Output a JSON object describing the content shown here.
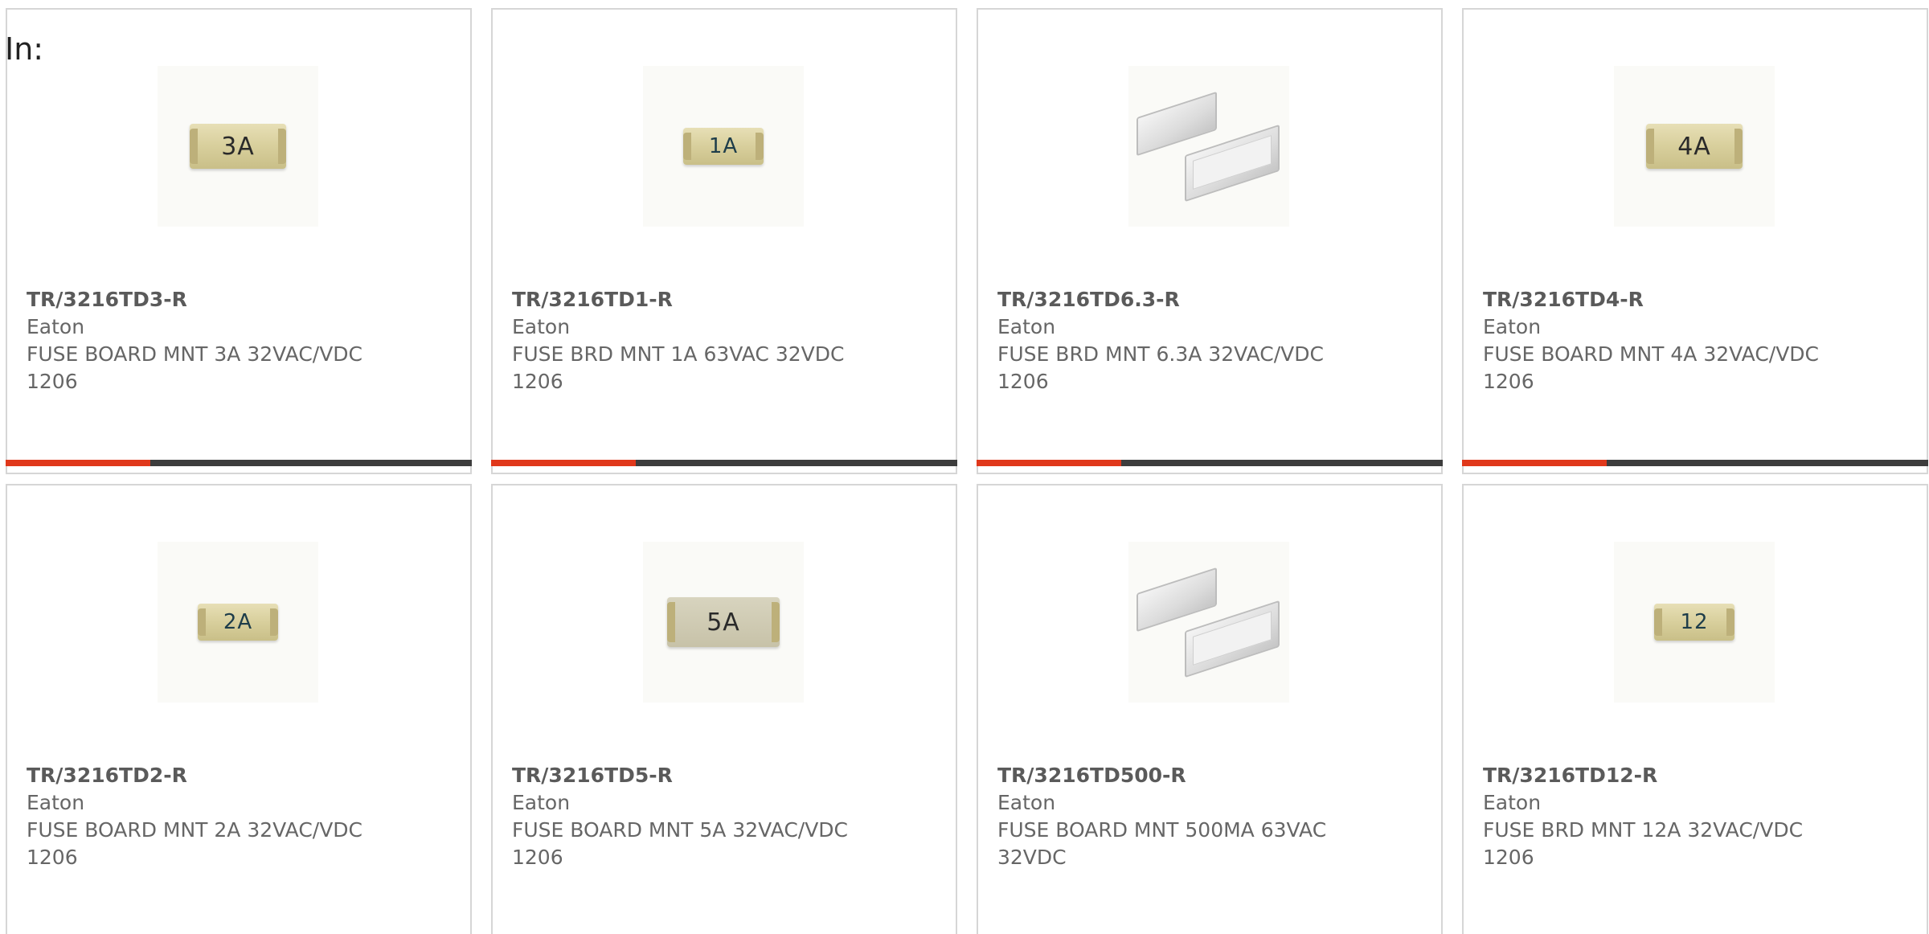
{
  "filter": {
    "label": "In:"
  },
  "colors": {
    "accent": "#e0381b",
    "track": "#3d3d3d",
    "border": "#d6d6d6"
  },
  "products": [
    {
      "part_number": "TR/3216TD3-R",
      "manufacturer": "Eaton",
      "description": "FUSE BOARD MNT 3A 32VAC/VDC",
      "package": "1206",
      "image_label": "3A",
      "image_type": "fuse",
      "progress": 0.31
    },
    {
      "part_number": "TR/3216TD1-R",
      "manufacturer": "Eaton",
      "description": "FUSE BRD MNT 1A 63VAC 32VDC",
      "package": "1206",
      "image_label": "1A",
      "image_type": "fuse-small",
      "progress": 0.31
    },
    {
      "part_number": "TR/3216TD6.3-R",
      "manufacturer": "Eaton",
      "description": "FUSE BRD MNT 6.3A 32VAC/VDC",
      "package": "1206",
      "image_label": "",
      "image_type": "chips",
      "progress": 0.31
    },
    {
      "part_number": "TR/3216TD4-R",
      "manufacturer": "Eaton",
      "description": "FUSE BOARD MNT 4A 32VAC/VDC",
      "package": "1206",
      "image_label": "4A",
      "image_type": "fuse",
      "progress": 0.31
    },
    {
      "part_number": "TR/3216TD2-R",
      "manufacturer": "Eaton",
      "description": "FUSE BOARD MNT 2A 32VAC/VDC",
      "package": "1206",
      "image_label": "2A",
      "image_type": "fuse-small",
      "progress": null
    },
    {
      "part_number": "TR/3216TD5-R",
      "manufacturer": "Eaton",
      "description": "FUSE BOARD MNT 5A 32VAC/VDC",
      "package": "1206",
      "image_label": "5A",
      "image_type": "fuse-large",
      "progress": null
    },
    {
      "part_number": "TR/3216TD500-R",
      "manufacturer": "Eaton",
      "description": "FUSE BOARD MNT 500MA 63VAC 32VDC",
      "package": "",
      "image_label": "",
      "image_type": "chips",
      "progress": null
    },
    {
      "part_number": "TR/3216TD12-R",
      "manufacturer": "Eaton",
      "description": "FUSE BRD MNT 12A 32VAC/VDC",
      "package": "1206",
      "image_label": "12",
      "image_type": "fuse-small",
      "progress": null
    }
  ]
}
